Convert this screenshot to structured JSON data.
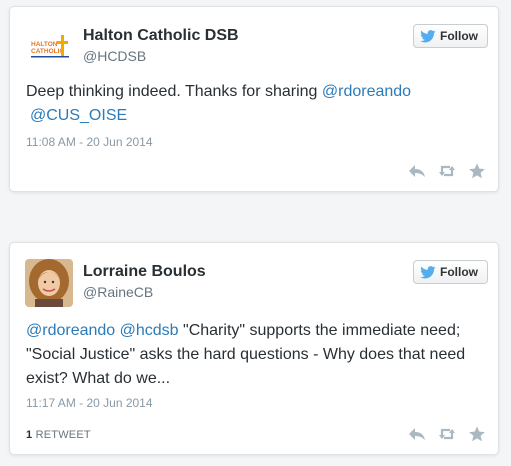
{
  "tweets": [
    {
      "author_name": "Halton Catholic DSB",
      "handle": "@HCDSB",
      "follow_label": "Follow",
      "text_parts": [
        "Deep thinking indeed. Thanks for sharing ",
        "@rdoreando",
        " ",
        "@CUS_OISE"
      ],
      "timestamp": "11:08 AM - 20 Jun 2014",
      "logo_text": [
        "HALTON",
        "CATHOLIC"
      ]
    },
    {
      "author_name": "Lorraine Boulos",
      "handle": "@RaineCB",
      "follow_label": "Follow",
      "text_parts": [
        "@rdoreando",
        " ",
        "@hcdsb",
        " \"Charity\" supports the immediate need; \"Social Justice\" asks the hard questions - Why does that need exist? What do we..."
      ],
      "timestamp": "11:17 AM - 20 Jun 2014",
      "retweet_count": "1",
      "retweet_label": "RETWEET"
    }
  ],
  "icons": {
    "bird": "twitter-bird-icon",
    "reply": "reply-icon",
    "retweet": "retweet-icon",
    "favorite": "star-icon"
  },
  "colors": {
    "link": "#2b7bb9",
    "bird": "#55acee",
    "icon_gray": "#aab8c2"
  }
}
